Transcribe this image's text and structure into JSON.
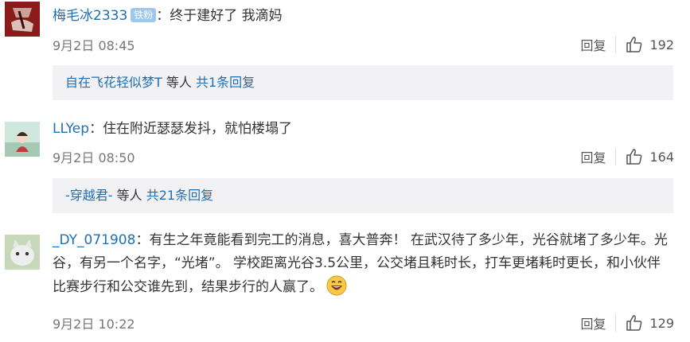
{
  "comments": [
    {
      "username": "梅毛冰2333",
      "badge": "铁粉",
      "separator": "：",
      "text": "终于建好了 我滴妈",
      "time": "9月2日 08:45",
      "reply_label": "回复",
      "likes": "192",
      "replies": {
        "name": "自在飞花轻似梦T",
        "mid": " 等人 ",
        "count": "共1条回复"
      }
    },
    {
      "username": "LLYep",
      "separator": "：",
      "text": "住在附近瑟瑟发抖，就怕楼塌了",
      "time": "9月2日 08:50",
      "reply_label": "回复",
      "likes": "164",
      "replies": {
        "name": "-穿越君-",
        "mid": " 等人 ",
        "count": "共21条回复"
      }
    },
    {
      "username": "_DY_071908",
      "separator": "：",
      "text": "有生之年竟能看到完工的消息，喜大普奔！ 在武汉待了多少年，光谷就堵了多少年。光谷，有另一个名字，“光堵”。 学校距离光谷3.5公里，公交堵且耗时长，打车更堵耗时更长，和小伙伴比赛步行和公交谁先到，结果步行的人赢了。",
      "time": "9月2日 10:22",
      "reply_label": "回复",
      "likes": "129"
    }
  ],
  "colors": {
    "link": "#1f6fb5",
    "reply_bg": "#f2f2f5",
    "badge_bg": "#9ec7ec"
  }
}
